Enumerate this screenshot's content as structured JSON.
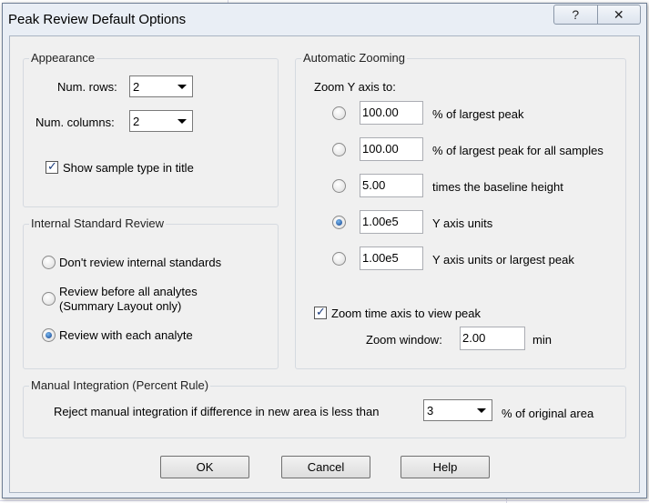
{
  "window": {
    "title": "Peak Review Default Options",
    "help_glyph": "?",
    "close_glyph": "✕"
  },
  "appearance": {
    "label": "Appearance",
    "rows_label": "Num. rows:",
    "rows_value": "2",
    "columns_label": "Num. columns:",
    "columns_value": "2",
    "show_type_label": "Show sample type in title",
    "show_type_checked": true
  },
  "internal_standard": {
    "label": "Internal Standard Review",
    "options": [
      {
        "label": "Don't review internal standards",
        "selected": false
      },
      {
        "label": "Review before all analytes",
        "label2": "(Summary Layout only)",
        "selected": false
      },
      {
        "label": "Review with each analyte",
        "selected": true
      }
    ]
  },
  "zooming": {
    "label": "Automatic Zooming",
    "zoom_y_label": "Zoom Y axis to:",
    "options": [
      {
        "value": "100.00",
        "label": "% of largest peak",
        "selected": false
      },
      {
        "value": "100.00",
        "label": "% of largest peak for all samples",
        "selected": false
      },
      {
        "value": "5.00",
        "label": "times the baseline height",
        "selected": false
      },
      {
        "value": "1.00e5",
        "label": "Y axis units",
        "selected": true
      },
      {
        "value": "1.00e5",
        "label": "Y axis units or largest peak",
        "selected": false
      }
    ],
    "zoom_time_label": "Zoom time axis to view peak",
    "zoom_time_checked": true,
    "window_label": "Zoom window:",
    "window_value": "2.00",
    "window_unit": "min"
  },
  "manual": {
    "label": "Manual Integration (Percent Rule)",
    "reject_label": "Reject manual integration if difference in new area is less than",
    "percent_value": "3",
    "suffix": "% of original area"
  },
  "buttons": {
    "ok": "OK",
    "cancel": "Cancel",
    "help": "Help"
  }
}
